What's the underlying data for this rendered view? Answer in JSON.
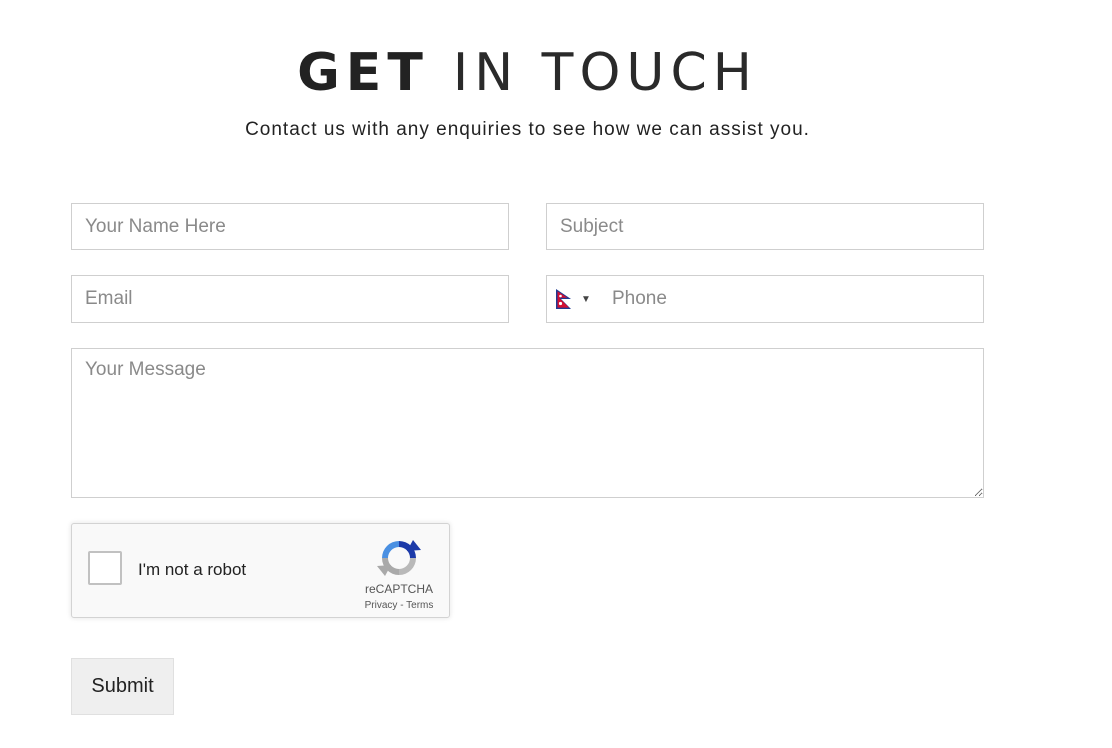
{
  "header": {
    "title_bold": "GET",
    "title_light": "IN TOUCH",
    "subtitle": "Contact us with any enquiries to see how we can assist you."
  },
  "form": {
    "name_placeholder": "Your Name Here",
    "subject_placeholder": "Subject",
    "email_placeholder": "Email",
    "phone_placeholder": "Phone",
    "phone_country_icon": "nepal-flag-icon",
    "message_placeholder": "Your Message",
    "submit_label": "Submit"
  },
  "recaptcha": {
    "checkbox_label": "I'm not a robot",
    "brand": "reCAPTCHA",
    "privacy_label": "Privacy",
    "separator": "-",
    "terms_label": "Terms"
  }
}
